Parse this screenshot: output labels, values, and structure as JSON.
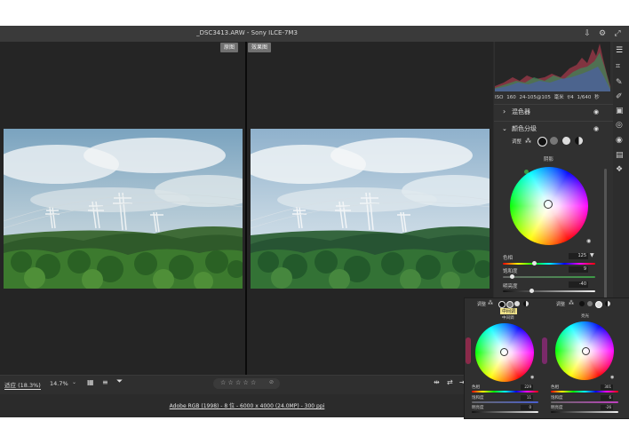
{
  "window": {
    "title": "_DSC3413.ARW  -  Sony ILCE-7M3"
  },
  "viewer": {
    "before_label": "原图",
    "after_label": "效果图"
  },
  "camera_info": {
    "iso": "ISO 160",
    "lens": "24-105@105 毫米",
    "aperture": "f/4",
    "shutter": "1/640 秒"
  },
  "panels": {
    "mixer": {
      "title": "混色器"
    },
    "grading": {
      "title": "颜色分级",
      "adjust_label": "调整",
      "wheel_title": "阴影",
      "hue": {
        "label": "色相",
        "value": "125"
      },
      "saturation": {
        "label": "饱和度",
        "value": "9"
      },
      "luminance": {
        "label": "明亮度",
        "value": "-40"
      }
    }
  },
  "overlay": {
    "adjust_label": "调整",
    "tooltip": "中间调",
    "left": {
      "title": "中间调",
      "hue_label": "色相",
      "hue_value": "229",
      "sat_label": "饱和度",
      "sat_value": "11",
      "lum_label": "明亮度",
      "lum_value": "0"
    },
    "right": {
      "title": "亮光",
      "hue_label": "色相",
      "hue_value": "301",
      "sat_label": "饱和度",
      "sat_value": "6",
      "lum_label": "明亮度",
      "lum_value": "-26"
    }
  },
  "bottom": {
    "fit_label": "适应 (18.3%)",
    "zoom_label": "14.7%",
    "stars": "☆ ☆ ☆ ☆ ☆"
  },
  "footer": {
    "info": "Adobe RGB (1998) - 8 位 - 6000 x 4000 (24.0MP) - 300 ppi"
  }
}
